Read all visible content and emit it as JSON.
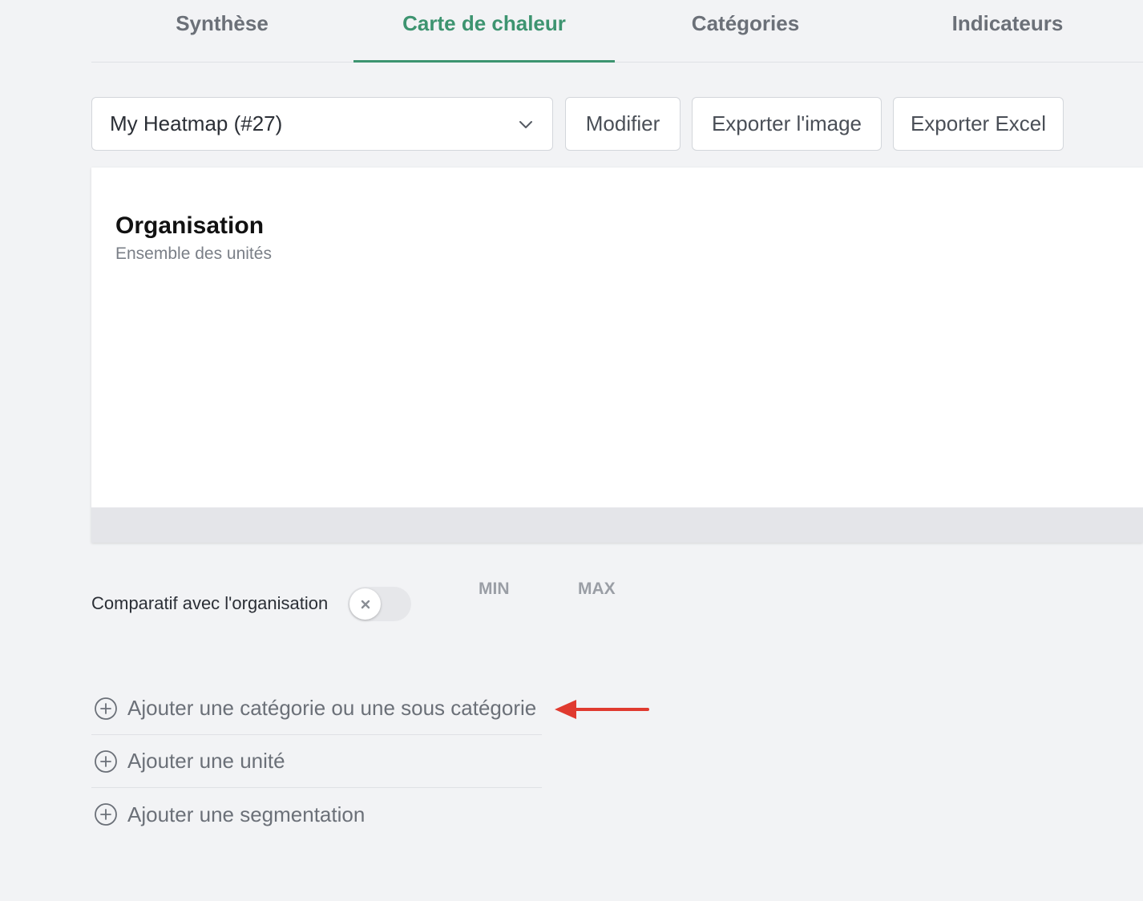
{
  "tabs": [
    {
      "label": "Synthèse"
    },
    {
      "label": "Carte de chaleur",
      "active": true
    },
    {
      "label": "Catégories"
    },
    {
      "label": "Indicateurs"
    }
  ],
  "toolbar": {
    "heatmap_select_value": "My Heatmap (#27)",
    "modify_label": "Modifier",
    "export_image_label": "Exporter l'image",
    "export_excel_label": "Exporter Excel"
  },
  "card": {
    "title": "Organisation",
    "subtitle": "Ensemble des unités"
  },
  "compare": {
    "label": "Comparatif avec l'organisation",
    "enabled": false,
    "min_label": "MIN",
    "max_label": "MAX"
  },
  "actions": [
    {
      "label": "Ajouter une catégorie ou une sous catégorie"
    },
    {
      "label": "Ajouter une unité"
    },
    {
      "label": "Ajouter une segmentation"
    }
  ],
  "colors": {
    "accent": "#3d9470",
    "annotation_arrow": "#e03a2f"
  },
  "icons": {
    "select": "chevron-down-icon",
    "toggle_off": "x-icon",
    "action": "plus-circle-icon",
    "annotation": "arrow-left-icon"
  }
}
